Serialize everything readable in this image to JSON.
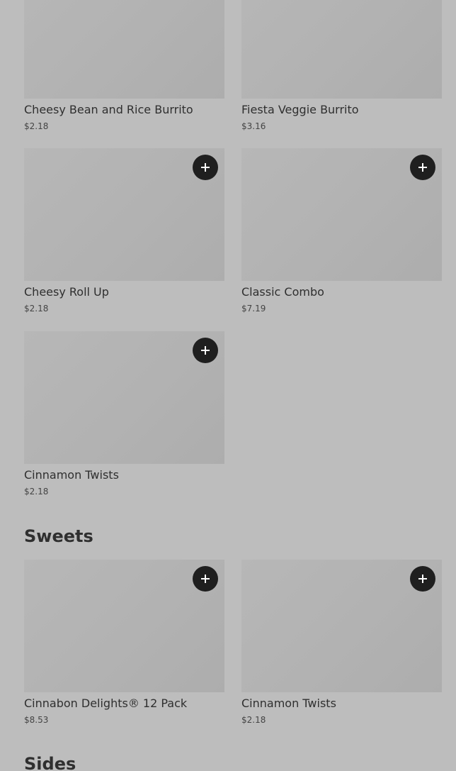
{
  "top_grid": {
    "items": [
      {
        "name": "Cheesy Bean and Rice Burrito",
        "price": "$2.18"
      },
      {
        "name": "Fiesta Veggie Burrito",
        "price": "$3.16"
      },
      {
        "name": "Cheesy Roll Up",
        "price": "$2.18"
      },
      {
        "name": "Classic Combo",
        "price": "$7.19"
      },
      {
        "name": "Cinnamon Twists",
        "price": "$2.18"
      }
    ]
  },
  "sweets": {
    "title": "Sweets",
    "items": [
      {
        "name": "Cinnabon Delights® 12 Pack",
        "price": "$8.53"
      },
      {
        "name": "Cinnamon Twists",
        "price": "$2.18"
      }
    ]
  },
  "sides": {
    "title": "Sides"
  },
  "icons": {
    "add": "plus-icon"
  },
  "colors": {
    "background": "#bdbdbd",
    "card_image": "#b4b4b4",
    "button": "#1f1f1f",
    "text": "#2f2f2f"
  }
}
